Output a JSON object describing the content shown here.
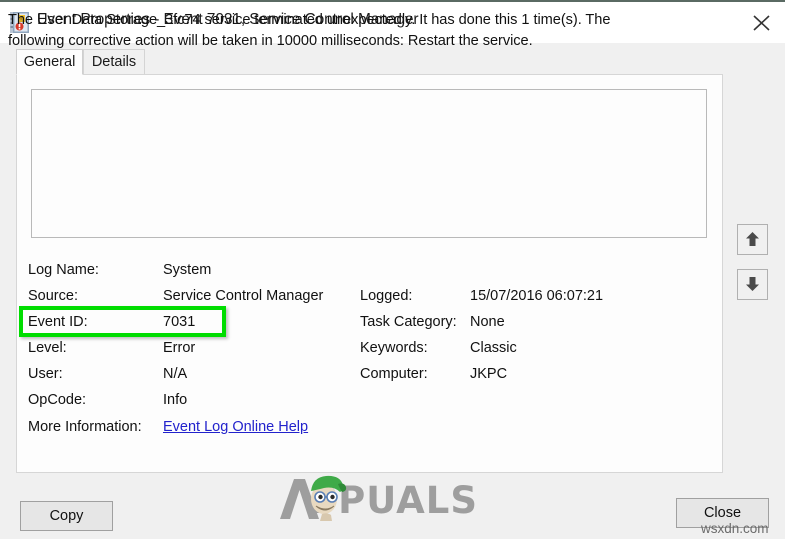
{
  "window": {
    "title": "Event Properties - Event 7031, Service Control Manager",
    "icon": "event-properties-icon",
    "close_icon": "close-icon"
  },
  "tabs": [
    {
      "label": "General",
      "active": true
    },
    {
      "label": "Details",
      "active": false
    }
  ],
  "description": "The User Data Storage_3fc74 service terminated unexpectedly. It has done this 1 time(s). The following corrective action will be taken in 10000 milliseconds: Restart the service.",
  "fields_left": [
    {
      "label": "Log Name:",
      "value": "System"
    },
    {
      "label": "Source:",
      "value": "Service Control Manager"
    },
    {
      "label": "Event ID:",
      "value": "7031"
    },
    {
      "label": "Level:",
      "value": "Error"
    },
    {
      "label": "User:",
      "value": "N/A"
    },
    {
      "label": "OpCode:",
      "value": "Info"
    }
  ],
  "more_information": {
    "label": "More Information:",
    "link_text": "Event Log Online Help"
  },
  "fields_right": [
    {
      "label": "Logged:",
      "value": "15/07/2016 06:07:21"
    },
    {
      "label": "Task Category:",
      "value": "None"
    },
    {
      "label": "Keywords:",
      "value": "Classic"
    },
    {
      "label": "Computer:",
      "value": "JKPC"
    }
  ],
  "nav_buttons": [
    {
      "name": "previous-event-button",
      "icon": "arrow-up-icon"
    },
    {
      "name": "next-event-button",
      "icon": "arrow-down-icon"
    }
  ],
  "buttons": {
    "copy": "Copy",
    "close": "Close"
  },
  "highlight": {
    "target": "Event ID:",
    "color": "#00dd00"
  },
  "watermarks": {
    "appuals": "PPUALS",
    "wsxdn": "wsxdn.com"
  }
}
